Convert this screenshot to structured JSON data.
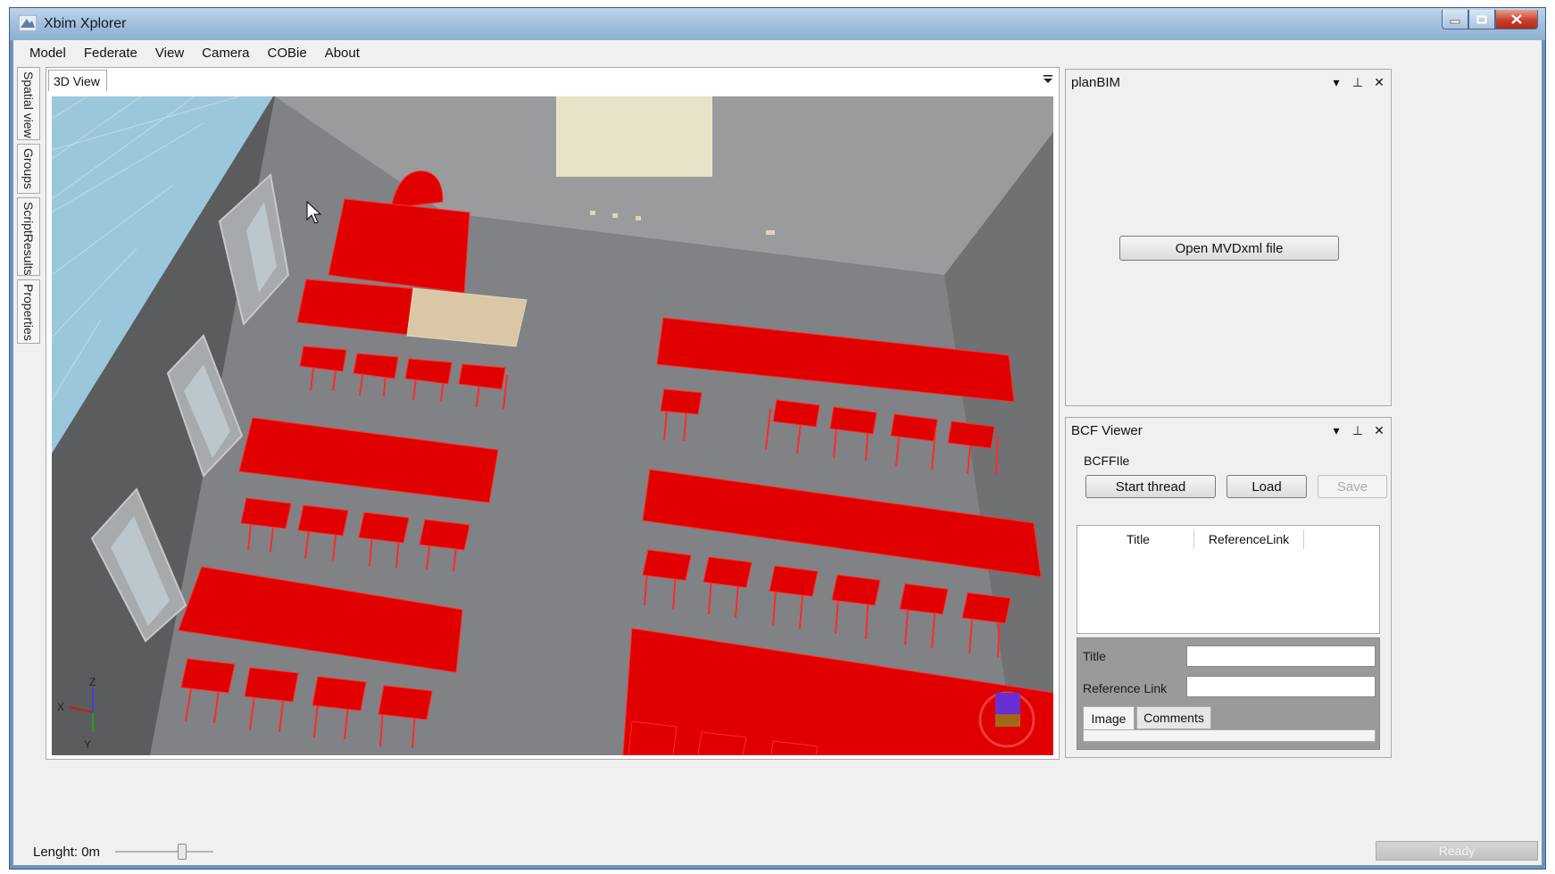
{
  "window": {
    "title": "Xbim Xplorer",
    "controls": {
      "minimize": "minimize-icon",
      "maximize": "maximize-icon",
      "close": "close-icon"
    }
  },
  "menu": {
    "items": [
      {
        "label": "Model"
      },
      {
        "label": "Federate"
      },
      {
        "label": "View"
      },
      {
        "label": "Camera"
      },
      {
        "label": "COBie"
      },
      {
        "label": "About"
      }
    ]
  },
  "side_tabs": [
    {
      "label": "Spatial view"
    },
    {
      "label": "Groups"
    },
    {
      "label": "ScriptResults"
    },
    {
      "label": "Properties"
    }
  ],
  "doc": {
    "tab_label": "3D View",
    "axis": {
      "z": "Z",
      "x": "X",
      "y": "Y"
    }
  },
  "planbim": {
    "title": "planBIM",
    "open_button": "Open MVDxml file"
  },
  "bcf": {
    "title": "BCF Viewer",
    "group_label": "BCFFIle",
    "start_button": "Start thread",
    "load_button": "Load",
    "save_button": "Save",
    "columns": [
      "Title",
      "ReferenceLink"
    ],
    "title_label": "Title",
    "title_value": "",
    "reference_label": "Reference Link",
    "reference_value": "",
    "tabs": [
      "Image",
      "Comments"
    ]
  },
  "status": {
    "length_text": "Lenght: 0m",
    "length_value": 0,
    "slider_level": 0.7,
    "ready_text": "Ready"
  },
  "colors": {
    "furniture": "#e00000",
    "floor": "#808285",
    "wall": "#5f6163",
    "titlebar": "#9fbbd9",
    "close_button": "#c8402c"
  }
}
